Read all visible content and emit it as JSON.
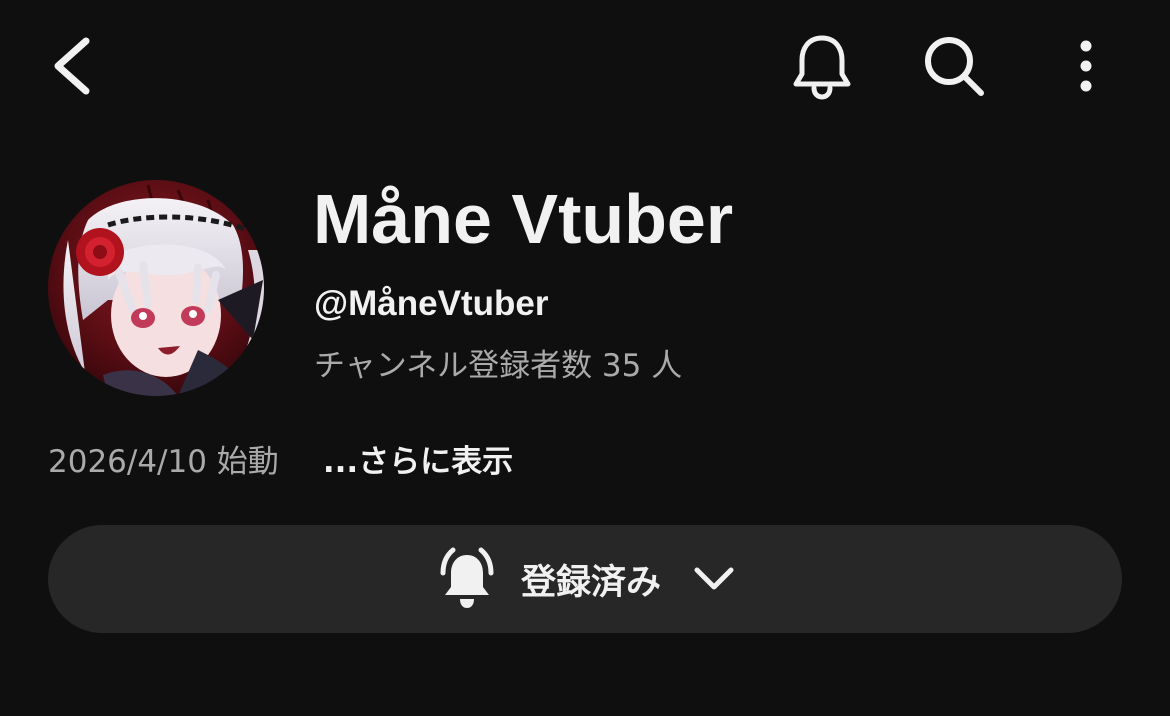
{
  "header": {
    "back_icon": "chevron-left-icon",
    "notification_icon": "bell-icon",
    "search_icon": "search-icon",
    "more_icon": "more-vertical-icon"
  },
  "channel": {
    "name": "Måne Vtuber",
    "handle": "@MåneVtuber",
    "subscribers": "チャンネル登録者数 35 人",
    "description": "2026/4/10 始動",
    "more_label": "...さらに表示"
  },
  "subscribe_button": {
    "label": "登録済み",
    "bell_icon": "bell-ringing-icon",
    "dropdown_icon": "chevron-down-icon",
    "background": "#272727"
  },
  "colors": {
    "background": "#0f0f0f",
    "text_primary": "#f1f1f1",
    "text_secondary": "#aaaaaa"
  }
}
